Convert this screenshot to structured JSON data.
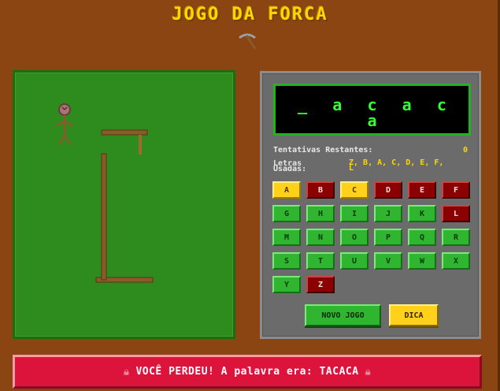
{
  "header": {
    "title": "JOGO DA FORCA"
  },
  "word": {
    "line1": [
      "_",
      "a",
      "c",
      "a",
      "c"
    ],
    "line2": "a"
  },
  "stats": {
    "attempts_label": "Tentativas Restantes:",
    "attempts_value": "0",
    "used_label_1": "Letras",
    "used_label_2": "Usadas:",
    "used_value_1": "Z, B, A, C, D, E, F,",
    "used_value_2": "L"
  },
  "keyboard": [
    {
      "l": "A",
      "s": "yellow"
    },
    {
      "l": "B",
      "s": "red"
    },
    {
      "l": "C",
      "s": "yellow"
    },
    {
      "l": "D",
      "s": "red"
    },
    {
      "l": "E",
      "s": "red"
    },
    {
      "l": "F",
      "s": "red"
    },
    {
      "l": "G",
      "s": "green"
    },
    {
      "l": "H",
      "s": "green"
    },
    {
      "l": "I",
      "s": "green"
    },
    {
      "l": "J",
      "s": "green"
    },
    {
      "l": "K",
      "s": "green"
    },
    {
      "l": "L",
      "s": "red"
    },
    {
      "l": "M",
      "s": "green"
    },
    {
      "l": "N",
      "s": "green"
    },
    {
      "l": "O",
      "s": "green"
    },
    {
      "l": "P",
      "s": "green"
    },
    {
      "l": "Q",
      "s": "green"
    },
    {
      "l": "R",
      "s": "green"
    },
    {
      "l": "S",
      "s": "green"
    },
    {
      "l": "T",
      "s": "green"
    },
    {
      "l": "U",
      "s": "green"
    },
    {
      "l": "V",
      "s": "green"
    },
    {
      "l": "W",
      "s": "green"
    },
    {
      "l": "X",
      "s": "green"
    },
    {
      "l": "Y",
      "s": "green"
    },
    {
      "l": "Z",
      "s": "red"
    }
  ],
  "buttons": {
    "new_game": "NOVO JOGO",
    "hint": "DICA"
  },
  "result": {
    "message": "VOCÊ PERDEU! A palavra era: TACACA",
    "icon": "skull-icon"
  },
  "colors": {
    "background": "#8a4513",
    "scene": "#2e8b1e",
    "banner": "#dc143c",
    "title": "#ffd700"
  }
}
